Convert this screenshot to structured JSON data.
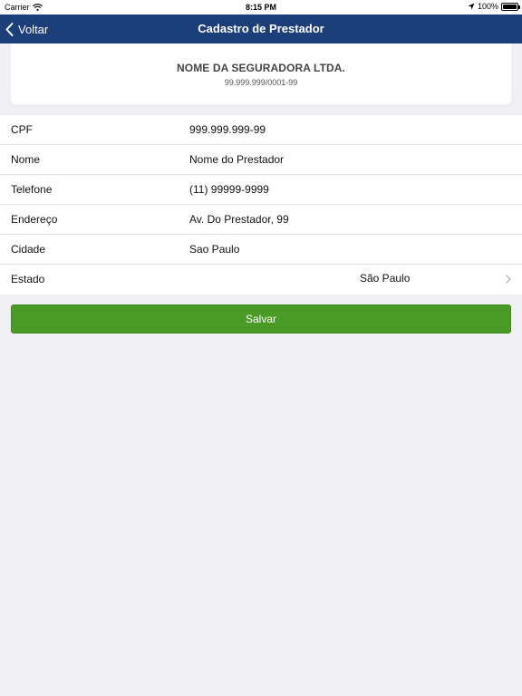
{
  "status_bar": {
    "carrier": "Carrier",
    "time": "8:15 PM",
    "battery": "100%"
  },
  "nav": {
    "back_label": "Voltar",
    "title": "Cadastro de Prestador"
  },
  "company": {
    "name": "NOME DA SEGURADORA LTDA.",
    "cnpj": "99.999.999/0001-99"
  },
  "form": {
    "rows": [
      {
        "label": "CPF",
        "value": "999.999.999-99"
      },
      {
        "label": "Nome",
        "value": "Nome do Prestador"
      },
      {
        "label": "Telefone",
        "value": "(11) 99999-9999"
      },
      {
        "label": "Endereço",
        "value": "Av. Do Prestador, 99"
      },
      {
        "label": "Cidade",
        "value": "Sao Paulo"
      },
      {
        "label": "Estado",
        "value": "São Paulo"
      }
    ]
  },
  "save_label": "Salvar",
  "colors": {
    "nav_bar": "#1c3f7a",
    "save_button": "#4a9a26",
    "background": "#efeff4"
  },
  "icons": {
    "back": "chevron-left-icon",
    "wifi": "wifi-icon",
    "location": "location-arrow-icon",
    "battery": "battery-icon",
    "disclosure": "chevron-right-icon"
  }
}
